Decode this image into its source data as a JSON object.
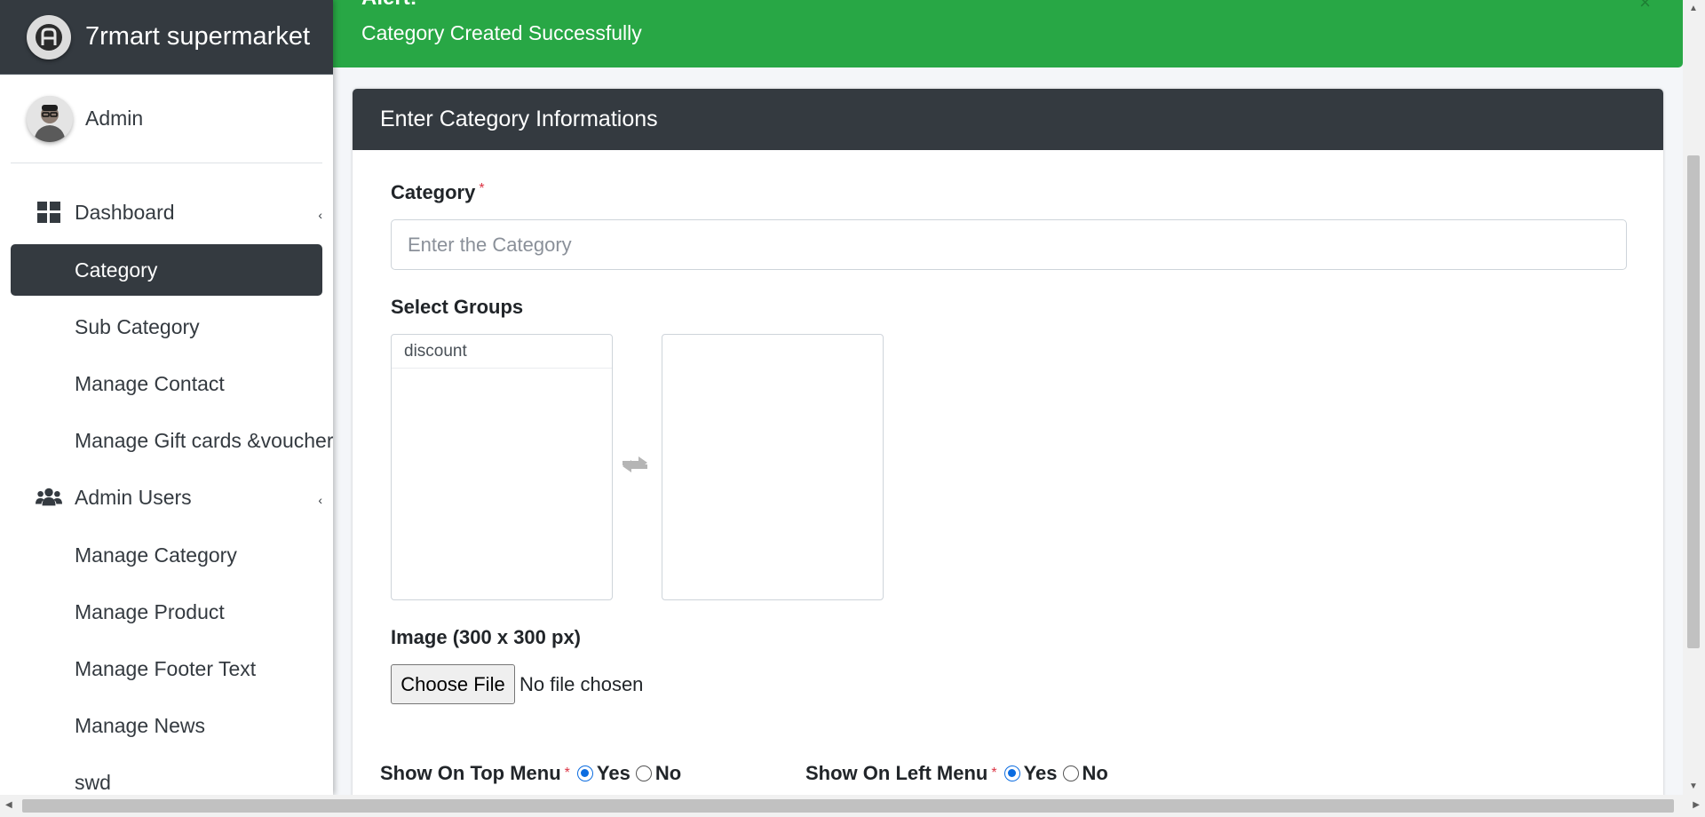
{
  "brand": {
    "name": "7rmart supermarket"
  },
  "user": {
    "name": "Admin"
  },
  "nav": {
    "dashboard": "Dashboard",
    "category": "Category",
    "sub_category": "Sub Category",
    "manage_contact": "Manage Contact",
    "manage_gift_cards": "Manage Gift cards &voucher",
    "admin_users": "Admin Users",
    "manage_category": "Manage Category",
    "manage_product": "Manage Product",
    "manage_footer_text": "Manage Footer Text",
    "manage_news": "Manage News",
    "swd": "swd"
  },
  "alert": {
    "title": "Alert!",
    "message": "Category Created Successfully",
    "close": "×"
  },
  "form": {
    "title": "Enter Category Informations",
    "category_label": "Category",
    "required_mark": "*",
    "category_placeholder": "Enter the Category",
    "category_value": "",
    "groups_label": "Select Groups",
    "available_groups": [
      "discount"
    ],
    "selected_groups": [],
    "image_label": "Image (300 x 300 px)",
    "choose_file": "Choose File",
    "file_status": "No file chosen",
    "top_menu_label": "Show On Top Menu",
    "top_menu_value": "Yes",
    "left_menu_label": "Show On Left Menu",
    "left_menu_value": "Yes",
    "yes": "Yes",
    "no": "No"
  },
  "colors": {
    "sidebar_dark": "#343a40",
    "success": "#28a745",
    "required": "#dc3545",
    "radio_checked": "#0b6ce0"
  }
}
